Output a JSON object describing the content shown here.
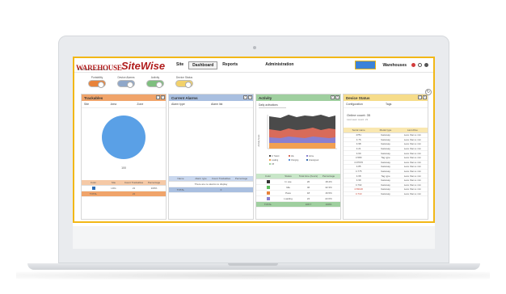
{
  "app": {
    "logo_main": "WAREHOUSE",
    "logo_sub": "OPERATIONS",
    "logo_product": "SiteWise"
  },
  "nav": [
    {
      "label": "Site",
      "active": false
    },
    {
      "label": "Dashboard",
      "active": true
    },
    {
      "label": "Reports",
      "active": false
    },
    {
      "label": "Administration",
      "active": false
    }
  ],
  "topright": {
    "location_label": "Warehouses"
  },
  "toggles": [
    {
      "label": "Portability",
      "color": "#e8833a"
    },
    {
      "label": "Device Alarms",
      "color": "#8fa7c9"
    },
    {
      "label": "Activity",
      "color": "#7fbf7f"
    },
    {
      "label": "Device Status",
      "color": "#f2d16b"
    }
  ],
  "colors": {
    "accent": "#f2b716",
    "orange": "#e8833a",
    "blue": "#9bb3d8",
    "green": "#8fc98f",
    "yellow": "#f4d77a",
    "pie": "#5aa0e6"
  },
  "panels": {
    "portability": {
      "title": "Trackables",
      "sub": [
        "Site",
        "Area",
        "Zone"
      ],
      "pie_label": "100",
      "table_head": [
        "Color",
        "Site",
        "Count Trackables",
        "Percentage"
      ],
      "rows": [
        [
          "",
          "LDG",
          "21",
          "100%"
        ]
      ],
      "total": [
        "TOTAL",
        "",
        "21",
        ""
      ]
    },
    "alarms": {
      "title": "Current Alarms",
      "sub": [
        "Alarm type",
        "Alarm list"
      ],
      "table_head": [
        "Name",
        "Alarm type",
        "Count Trackables",
        "Percentage"
      ],
      "empty": "There are no alarms to display",
      "total": [
        "TOTAL",
        "",
        "0",
        ""
      ]
    },
    "activity": {
      "title": "Activity",
      "dropdown": "Daily activations",
      "ylabel": "Activity hours",
      "legend": [
        "In Transit",
        "Idle",
        "Active",
        "Loading",
        "Charging",
        "Unassigned",
        "Off"
      ],
      "table_head": [
        "Color",
        "Status",
        "Total time (hours)",
        "Percentage"
      ],
      "rows": [
        [
          "",
          "In use",
          "20",
          "18.4%"
        ],
        [
          "",
          "Idle",
          "46",
          "42.3%"
        ],
        [
          "",
          "Pass",
          "18",
          "16.5%"
        ],
        [
          "",
          "Loading",
          "24",
          "22.0%"
        ]
      ],
      "total": [
        "TOTAL",
        "",
        "108.7",
        "100%"
      ]
    },
    "status": {
      "title": "Device Status",
      "sub": [
        "Configuration",
        "Tags"
      ],
      "online_count": "Online count: 35",
      "online_sub": "Last seen count: 21",
      "table_head": [
        "Serial name",
        "Model type",
        "Last Alive"
      ],
      "rows": [
        [
          "4781",
          "Gateway",
          "Less than a min"
        ],
        [
          "4.76",
          "Gateway",
          "Less than a min"
        ],
        [
          "4.98",
          "Gateway",
          "Less than a min"
        ],
        [
          "4.21",
          "Gateway",
          "Less than a min"
        ],
        [
          "4.60",
          "Gateway",
          "Less than a min"
        ],
        [
          "4.580",
          "Tag type",
          "Less than a min"
        ],
        [
          "4.97670",
          "Gateway",
          "Less than a min"
        ],
        [
          "4.85",
          "Gateway",
          "Less than a min"
        ],
        [
          "4.775",
          "Gateway",
          "Less than a min"
        ],
        [
          "4.68",
          "Tag type",
          "Less than a min"
        ],
        [
          "4.99",
          "Gateway",
          "Less than a min"
        ],
        [
          "4.702",
          "Gateway",
          "Less than a min"
        ],
        [
          "4.81120",
          "Gateway",
          "Less than a min"
        ],
        [
          "4.710",
          "Gateway",
          "Less than a min"
        ]
      ]
    }
  }
}
